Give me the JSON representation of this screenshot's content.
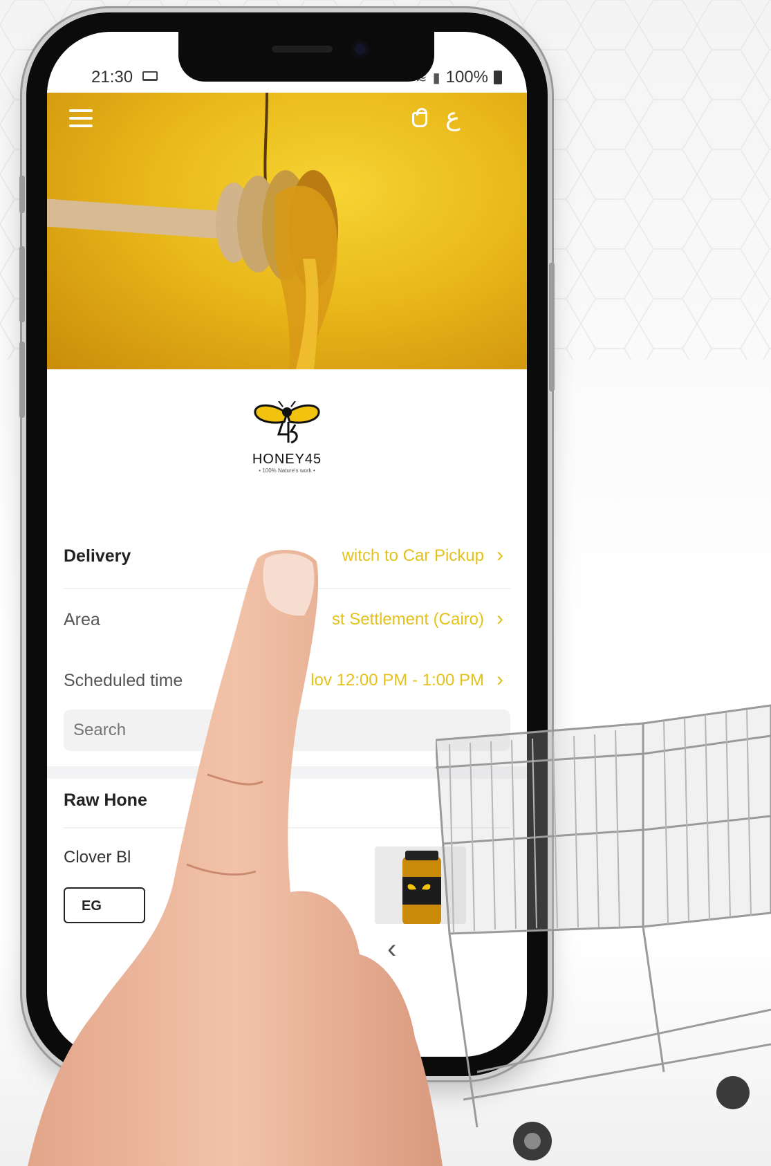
{
  "status_bar": {
    "time": "21:30",
    "battery": "100%"
  },
  "header": {
    "language_toggle": "ع"
  },
  "brand": {
    "name": "HONEY45",
    "tagline": "• 100% Nature's work •"
  },
  "delivery": {
    "title": "Delivery",
    "switch_label": "witch to Car Pickup",
    "area_label": "Area",
    "area_value": "st Settlement (Cairo)",
    "scheduled_label": "Scheduled time",
    "scheduled_value": "lov 12:00 PM - 1:00 PM"
  },
  "search": {
    "placeholder": "Search"
  },
  "category": {
    "title": "Raw Hone"
  },
  "product": {
    "name": "Clover Bl",
    "price_prefix": "EG"
  },
  "colors": {
    "accent": "#e4c11d",
    "hero": "#e9b81a"
  }
}
